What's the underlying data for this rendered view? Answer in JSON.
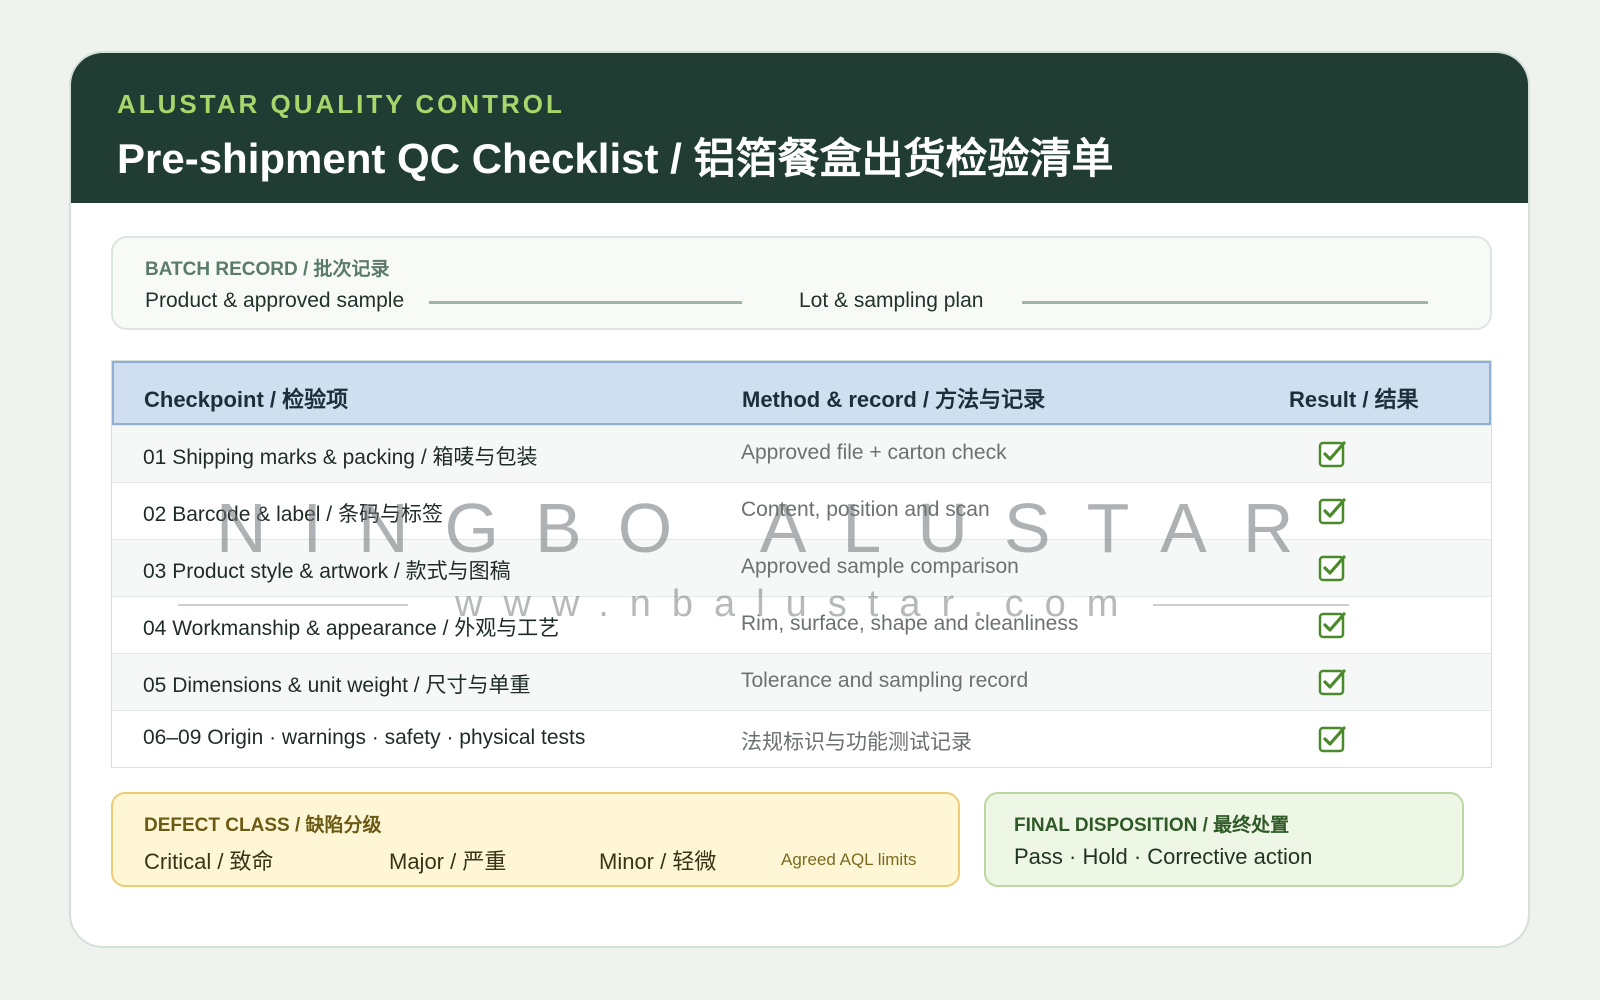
{
  "header": {
    "kicker": "ALUSTAR QUALITY CONTROL",
    "title": "Pre-shipment QC Checklist / 铝箔餐盒出货检验清单"
  },
  "batch": {
    "label": "BATCH RECORD / 批次记录",
    "field1": "Product & approved sample",
    "field2": "Lot & sampling plan"
  },
  "table": {
    "headers": {
      "checkpoint": "Checkpoint / 检验项",
      "method": "Method & record / 方法与记录",
      "result": "Result / 结果"
    },
    "rows": [
      {
        "checkpoint": "01 Shipping marks & packing / 箱唛与包装",
        "method": "Approved file + carton check",
        "checked": true
      },
      {
        "checkpoint": "02 Barcode & label / 条码与标签",
        "method": "Content, position and scan",
        "checked": true
      },
      {
        "checkpoint": "03 Product style & artwork / 款式与图稿",
        "method": "Approved sample comparison",
        "checked": true
      },
      {
        "checkpoint": "04 Workmanship & appearance / 外观与工艺",
        "method": "Rim, surface, shape and cleanliness",
        "checked": true
      },
      {
        "checkpoint": "05 Dimensions & unit weight / 尺寸与单重",
        "method": "Tolerance and sampling record",
        "checked": true
      },
      {
        "checkpoint": "06–09 Origin · warnings · safety · physical tests",
        "method": "法规标识与功能测试记录",
        "checked": true
      }
    ]
  },
  "watermark": {
    "name": "NINGBO ALUSTAR",
    "url": "www.nbalustar.com"
  },
  "defect": {
    "label": "DEFECT CLASS / 缺陷分级",
    "items": [
      "Critical / 致命",
      "Major / 严重",
      "Minor / 轻微"
    ],
    "note": "Agreed AQL limits"
  },
  "final": {
    "label": "FINAL DISPOSITION / 最终处置",
    "value": "Pass · Hold · Corrective action"
  },
  "colors": {
    "header_bg": "#213d33",
    "kicker": "#a7d66b",
    "check_green": "#4a8a2a"
  }
}
